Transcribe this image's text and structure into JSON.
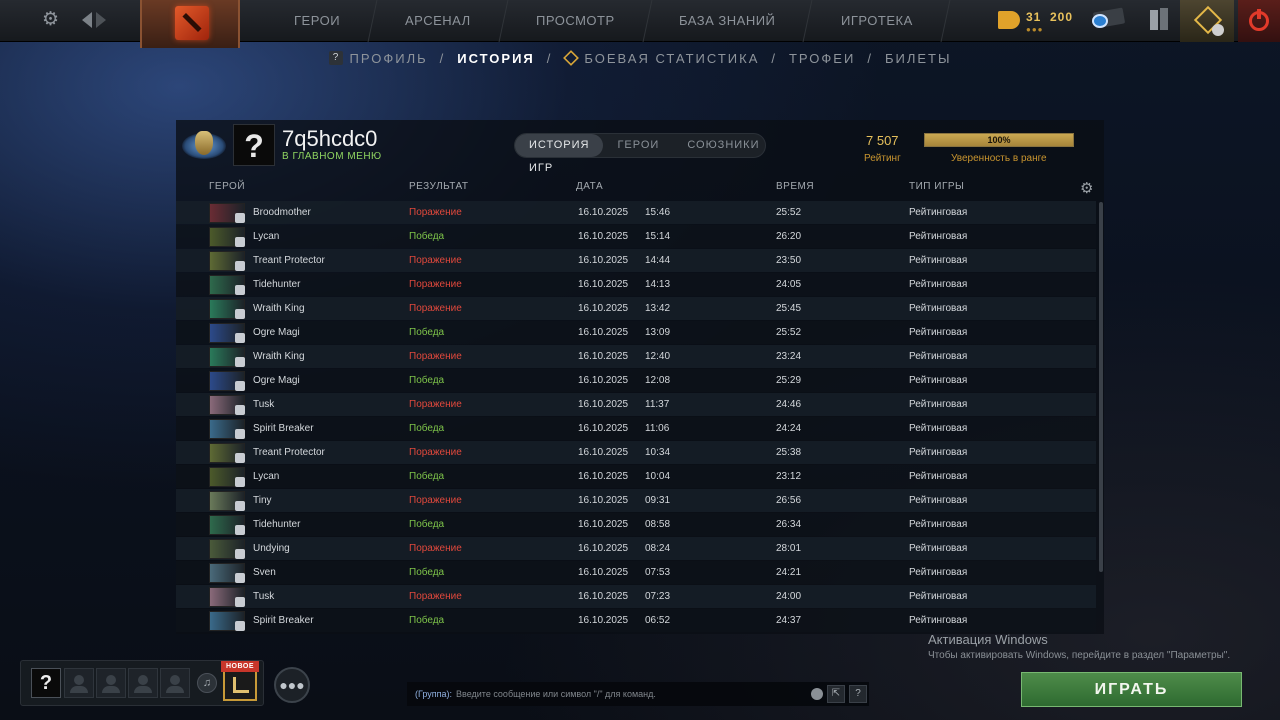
{
  "topnav": {
    "items": [
      "ГЕРОИ",
      "АРСЕНАЛ",
      "ПРОСМОТР",
      "БАЗА ЗНАНИЙ",
      "ИГРОТЕКА"
    ],
    "currency_a": "31",
    "currency_b": "200",
    "currency_dots": "●●●"
  },
  "subnav": {
    "profile": "ПРОФИЛЬ",
    "history": "ИСТОРИЯ",
    "stats": "БОЕВАЯ СТАТИСТИКА",
    "trophies": "ТРОФЕИ",
    "tickets": "БИЛЕТЫ",
    "separator": "/"
  },
  "player": {
    "avatar_glyph": "?",
    "name": "7q5hcdc0",
    "status": "В ГЛАВНОМ МЕНЮ",
    "rating_value": "7 507",
    "rating_label": "Рейтинг",
    "confidence_percent": 100,
    "confidence_text": "100%",
    "confidence_label": "Уверенность в ранге"
  },
  "tabs": [
    "ИСТОРИЯ ИГР",
    "ГЕРОИ",
    "СОЮЗНИКИ"
  ],
  "table": {
    "headers": {
      "hero": "ГЕРОЙ",
      "result": "РЕЗУЛЬТАТ",
      "date": "ДАТА",
      "duration": "ВРЕМЯ",
      "type": "ТИП ИГРЫ"
    },
    "rows": [
      {
        "hero": "Broodmother",
        "result": "Поражение",
        "win": false,
        "date": "16.10.2025",
        "time": "15:46",
        "duration": "25:52",
        "type": "Рейтинговая",
        "color": "#6a2c34"
      },
      {
        "hero": "Lycan",
        "result": "Победа",
        "win": true,
        "date": "16.10.2025",
        "time": "15:14",
        "duration": "26:20",
        "type": "Рейтинговая",
        "color": "#4c5a2a"
      },
      {
        "hero": "Treant Protector",
        "result": "Поражение",
        "win": false,
        "date": "16.10.2025",
        "time": "14:44",
        "duration": "23:50",
        "type": "Рейтинговая",
        "color": "#5e6a34"
      },
      {
        "hero": "Tidehunter",
        "result": "Поражение",
        "win": false,
        "date": "16.10.2025",
        "time": "14:13",
        "duration": "24:05",
        "type": "Рейтинговая",
        "color": "#2e6a4c"
      },
      {
        "hero": "Wraith King",
        "result": "Поражение",
        "win": false,
        "date": "16.10.2025",
        "time": "13:42",
        "duration": "25:45",
        "type": "Рейтинговая",
        "color": "#2a7a5a"
      },
      {
        "hero": "Ogre Magi",
        "result": "Победа",
        "win": true,
        "date": "16.10.2025",
        "time": "13:09",
        "duration": "25:52",
        "type": "Рейтинговая",
        "color": "#2c4a8a"
      },
      {
        "hero": "Wraith King",
        "result": "Поражение",
        "win": false,
        "date": "16.10.2025",
        "time": "12:40",
        "duration": "23:24",
        "type": "Рейтинговая",
        "color": "#2a7a5a"
      },
      {
        "hero": "Ogre Magi",
        "result": "Победа",
        "win": true,
        "date": "16.10.2025",
        "time": "12:08",
        "duration": "25:29",
        "type": "Рейтинговая",
        "color": "#2c4a8a"
      },
      {
        "hero": "Tusk",
        "result": "Поражение",
        "win": false,
        "date": "16.10.2025",
        "time": "11:37",
        "duration": "24:46",
        "type": "Рейтинговая",
        "color": "#8a6a7a"
      },
      {
        "hero": "Spirit Breaker",
        "result": "Победа",
        "win": true,
        "date": "16.10.2025",
        "time": "11:06",
        "duration": "24:24",
        "type": "Рейтинговая",
        "color": "#3a6a8a"
      },
      {
        "hero": "Treant Protector",
        "result": "Поражение",
        "win": false,
        "date": "16.10.2025",
        "time": "10:34",
        "duration": "25:38",
        "type": "Рейтинговая",
        "color": "#5e6a34"
      },
      {
        "hero": "Lycan",
        "result": "Победа",
        "win": true,
        "date": "16.10.2025",
        "time": "10:04",
        "duration": "23:12",
        "type": "Рейтинговая",
        "color": "#4c5a2a"
      },
      {
        "hero": "Tiny",
        "result": "Поражение",
        "win": false,
        "date": "16.10.2025",
        "time": "09:31",
        "duration": "26:56",
        "type": "Рейтинговая",
        "color": "#6a7a5a"
      },
      {
        "hero": "Tidehunter",
        "result": "Победа",
        "win": true,
        "date": "16.10.2025",
        "time": "08:58",
        "duration": "26:34",
        "type": "Рейтинговая",
        "color": "#2e6a4c"
      },
      {
        "hero": "Undying",
        "result": "Поражение",
        "win": false,
        "date": "16.10.2025",
        "time": "08:24",
        "duration": "28:01",
        "type": "Рейтинговая",
        "color": "#4a5a3a"
      },
      {
        "hero": "Sven",
        "result": "Победа",
        "win": true,
        "date": "16.10.2025",
        "time": "07:53",
        "duration": "24:21",
        "type": "Рейтинговая",
        "color": "#4a6a7a"
      },
      {
        "hero": "Tusk",
        "result": "Поражение",
        "win": false,
        "date": "16.10.2025",
        "time": "07:23",
        "duration": "24:00",
        "type": "Рейтинговая",
        "color": "#8a6a7a"
      },
      {
        "hero": "Spirit Breaker",
        "result": "Победа",
        "win": true,
        "date": "16.10.2025",
        "time": "06:52",
        "duration": "24:37",
        "type": "Рейтинговая",
        "color": "#3a6a8a"
      }
    ]
  },
  "windows_activation": {
    "title": "Активация Windows",
    "subtitle": "Чтобы активировать Windows, перейдите в раздел \"Параметры\"."
  },
  "party": {
    "my_slot_glyph": "?",
    "new_tag": "НОВОЕ"
  },
  "chat": {
    "prefix": "(Группа):",
    "placeholder": "Введите сообщение или символ \"/\" для команд.",
    "help_glyph": "?"
  },
  "play_button": "ИГРАТЬ",
  "colors": {
    "loss": "#e0483c",
    "win": "#7ec44a",
    "play": "#3e7c3c",
    "rating": "#e6c05c"
  }
}
